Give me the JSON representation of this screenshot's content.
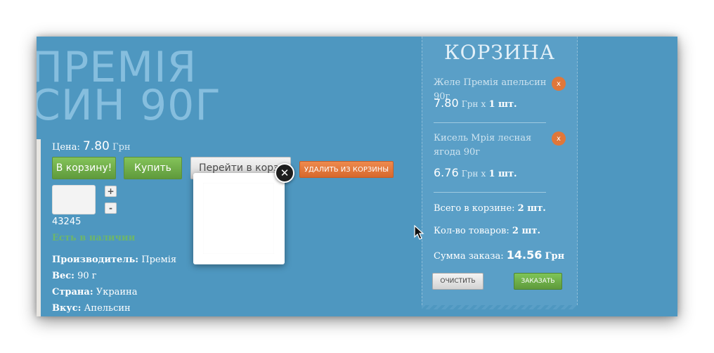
{
  "product": {
    "title_line1": "ПРЕМІЯ",
    "title_line2": "СИН 90Г",
    "price_label": "Цена:",
    "price_value": "7.80",
    "price_currency": "Грн",
    "add_to_cart_label": "В корзину!",
    "buy_label": "Купить",
    "go_to_cart_label": "Перейти в корзину",
    "remove_from_cart_label": "УДАЛИТЬ ИЗ КОРЗИНЫ",
    "qty_plus": "+",
    "qty_minus": "-",
    "sku": "43245",
    "stock_status": "Есть в наличии",
    "attributes": [
      {
        "label": "Производитель:",
        "value": "Премія"
      },
      {
        "label": "Вес:",
        "value": "90 г"
      },
      {
        "label": "Страна:",
        "value": "Украина"
      },
      {
        "label": "Вкус:",
        "value": "Апельсин"
      }
    ]
  },
  "popup": {
    "close_icon": "close-icon"
  },
  "cart": {
    "title": "КОРЗИНА",
    "items": [
      {
        "name": "Желе Премія апельсин 90г",
        "price": "7.80",
        "currency": "Грн",
        "x": "x",
        "qty": "1 шт.",
        "delete": "x"
      },
      {
        "name": "Кисель Мрія лесная ягода 90г",
        "price": "6.76",
        "currency": "Грн",
        "x": "x",
        "qty": "1 шт.",
        "delete": "x"
      }
    ],
    "total_in_cart_label": "Всего в корзине:",
    "total_in_cart_value": "2 шт.",
    "items_count_label": "Кол-во товаров:",
    "items_count_value": "2 шт.",
    "order_sum_label": "Сумма заказа:",
    "order_sum_value": "14.56",
    "order_sum_currency": "Грн",
    "clear_label": "ОЧИСТИТЬ",
    "order_label": "ЗАКАЗАТЬ"
  },
  "colors": {
    "background": "#4e97c0",
    "green": "#6aa84f",
    "orange": "#e0773a"
  }
}
